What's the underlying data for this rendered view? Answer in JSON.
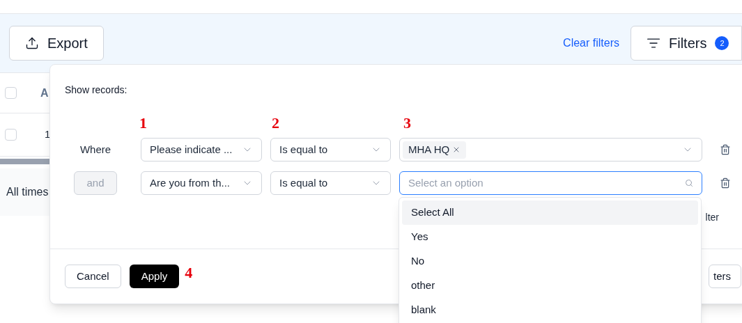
{
  "toolbar": {
    "export_button": "Export",
    "clear_filters": "Clear filters",
    "filters_button": {
      "label": "Filters",
      "count": "2"
    }
  },
  "table": {
    "header": {
      "checked": false,
      "column_1": "A"
    },
    "rows": [
      {
        "checked": false,
        "column_1": "1"
      }
    ]
  },
  "footer": {
    "text": "All times"
  },
  "filter_panel": {
    "title": "Show records:",
    "annotations": [
      "1",
      "2",
      "3",
      "4"
    ],
    "rows": [
      {
        "connector": {
          "kind": "text",
          "label": "Where",
          "disabled": false
        },
        "field": "Please indicate ...",
        "operator": "Is equal to",
        "value": {
          "kind": "tags",
          "tags": [
            "MHA HQ"
          ],
          "focused": false
        }
      },
      {
        "connector": {
          "kind": "button",
          "label": "and",
          "disabled": true
        },
        "field": "Are you from th...",
        "operator": "Is equal to",
        "value": {
          "kind": "search",
          "placeholder": "Select an option",
          "focused": true
        }
      }
    ],
    "add_filter_partial": "lter",
    "cancel_button": "Cancel",
    "apply_button": "Apply",
    "right_button_partial": "ters"
  },
  "dropdown": {
    "options": [
      {
        "label": "Select All",
        "highlighted": true
      },
      {
        "label": "Yes",
        "highlighted": false
      },
      {
        "label": "No",
        "highlighted": false
      },
      {
        "label": "other",
        "highlighted": false
      },
      {
        "label": "blank",
        "highlighted": false
      }
    ]
  }
}
